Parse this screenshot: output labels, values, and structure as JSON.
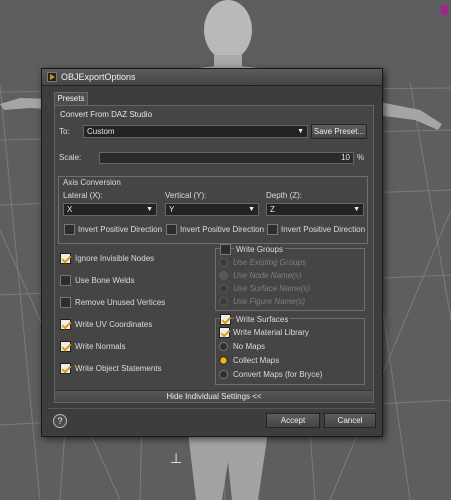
{
  "dialog": {
    "title": "OBJExportOptions",
    "tabs": [
      {
        "label": "Presets"
      }
    ]
  },
  "presets": {
    "section_title": "Convert From DAZ Studio",
    "to_label": "To:",
    "to_value": "Custom",
    "save_preset_label": "Save Preset...",
    "scale_label": "Scale:",
    "scale_value": "10",
    "scale_unit": "%"
  },
  "axis_conversion": {
    "title": "Axis Conversion",
    "lateral": {
      "label": "Lateral (X):",
      "value": "X",
      "invert_label": "Invert Positive Direction",
      "invert_checked": false
    },
    "vertical": {
      "label": "Vertical (Y):",
      "value": "Y",
      "invert_label": "Invert Positive Direction",
      "invert_checked": false
    },
    "depth": {
      "label": "Depth (Z):",
      "value": "Z",
      "invert_label": "Invert Positive Direction",
      "invert_checked": false
    }
  },
  "options": [
    {
      "label": "Ignore Invisible Nodes",
      "checked": true
    },
    {
      "label": "Use Bone Welds",
      "checked": false
    },
    {
      "label": "Remove Unused Vertices",
      "checked": false
    },
    {
      "label": "Write UV Coordinates",
      "checked": true
    },
    {
      "label": "Write Normals",
      "checked": true
    },
    {
      "label": "Write Object Statements",
      "checked": true
    }
  ],
  "write_groups": {
    "label": "Write Groups",
    "checked": false,
    "choices": [
      {
        "label": "Use Existing Groups",
        "selected": false
      },
      {
        "label": "Use Node Name(s)",
        "selected": true
      },
      {
        "label": "Use Surface Name(s)",
        "selected": false
      },
      {
        "label": "Use Figure Name(s)",
        "selected": false
      }
    ]
  },
  "write_surfaces": {
    "label": "Write Surfaces",
    "checked": true,
    "write_material_library": {
      "label": "Write Material Library",
      "checked": true
    },
    "maps": [
      {
        "label": "No Maps",
        "selected": false
      },
      {
        "label": "Collect Maps",
        "selected": true
      },
      {
        "label": "Convert Maps (for Bryce)",
        "selected": false
      }
    ]
  },
  "hide_settings_label": "Hide Individual Settings <<",
  "footer": {
    "help_label": "?",
    "accept_label": "Accept",
    "cancel_label": "Cancel"
  },
  "colors": {
    "viewport_bg": "#5e5e5e",
    "dialog_bg": "#3d3d3d",
    "check_accent": "#e19a18",
    "radio_accent": "#f4b31f"
  }
}
